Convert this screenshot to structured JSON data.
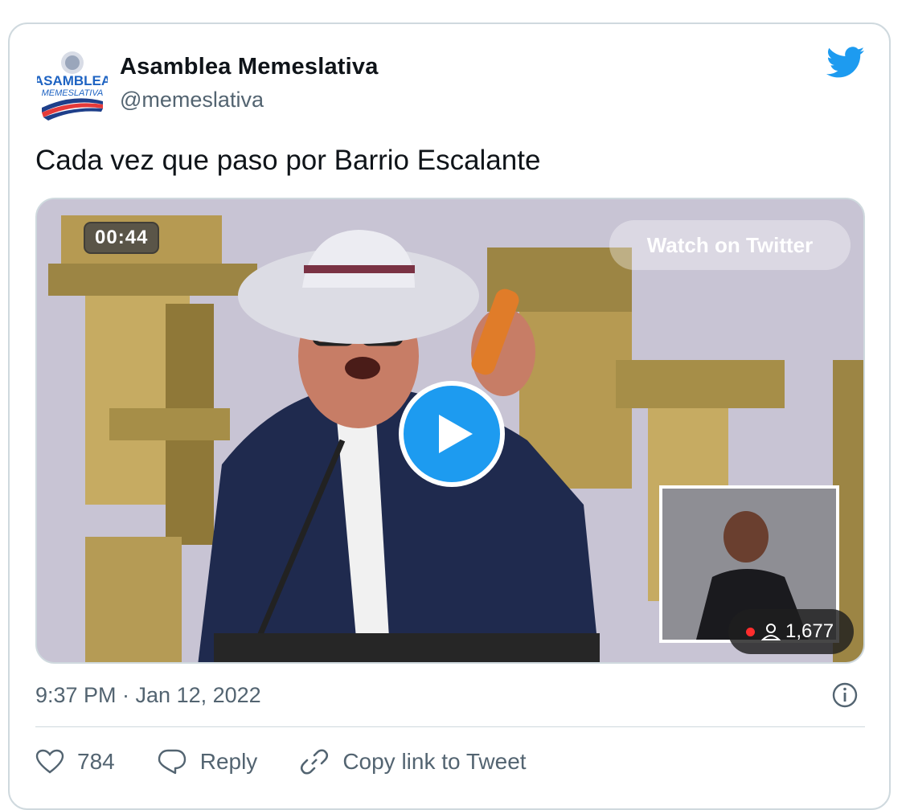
{
  "author": {
    "name": "Asamblea Memeslativa",
    "handle": "@memeslativa",
    "logo_text_top": "ASAMBLEA",
    "logo_text_bottom": "MEMESLATIVA"
  },
  "tweet": {
    "text": "Cada vez que paso por Barrio Escalante",
    "timestamp": "9:37 PM · Jan 12, 2022"
  },
  "video": {
    "duration": "00:44",
    "watch_label": "Watch on Twitter",
    "viewers": "1,677"
  },
  "actions": {
    "likes": "784",
    "reply_label": "Reply",
    "copy_link_label": "Copy link to Tweet"
  },
  "colors": {
    "twitter_blue": "#1d9bf0",
    "secondary_text": "#536471",
    "border": "#cfd9de"
  },
  "icons": [
    "twitter-bird-icon",
    "play-icon",
    "person-icon",
    "info-icon",
    "heart-icon",
    "reply-icon",
    "link-icon"
  ]
}
